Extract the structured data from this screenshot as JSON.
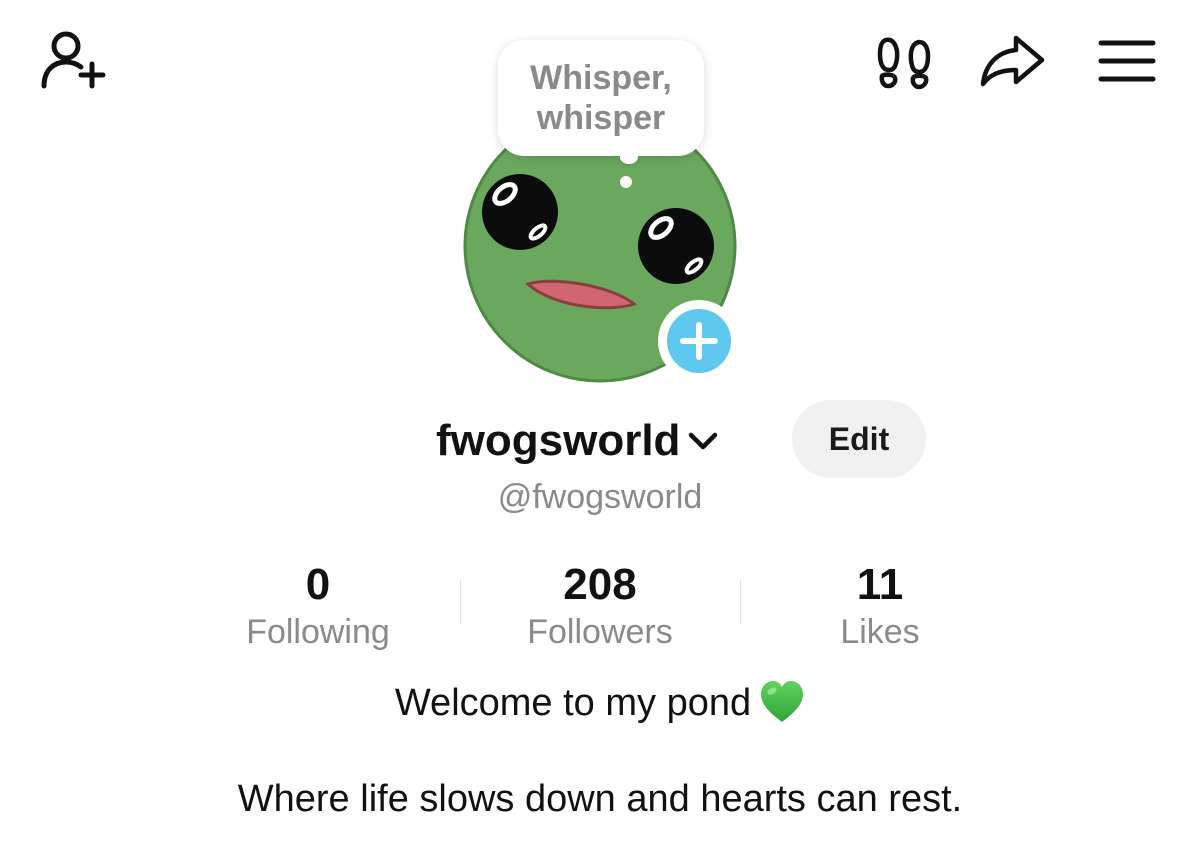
{
  "header": {
    "icons": [
      "add-friend-icon",
      "footprints-icon",
      "share-icon",
      "menu-icon"
    ]
  },
  "avatar": {
    "note": "Whisper, whisper",
    "add_icon": "plus-icon",
    "colors": {
      "frog_green": "#6aa85e",
      "add_button_blue": "#5ec8ee"
    }
  },
  "profile": {
    "display_name": "fwogsworld",
    "handle": "@fwogsworld",
    "edit_label": "Edit"
  },
  "stats": [
    {
      "value": "0",
      "label": "Following"
    },
    {
      "value": "208",
      "label": "Followers"
    },
    {
      "value": "11",
      "label": "Likes"
    }
  ],
  "bio": {
    "line1": "Welcome to my pond",
    "line1_emoji": "green-heart",
    "line2": "Where life slows down and hearts can rest."
  }
}
